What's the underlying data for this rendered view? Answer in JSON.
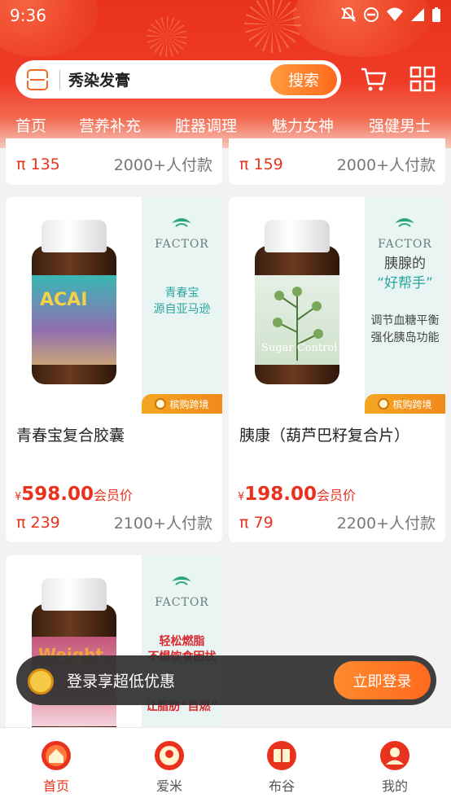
{
  "status_bar": {
    "time": "9:36"
  },
  "search": {
    "text": "秀染发膏",
    "button_label": "搜索"
  },
  "tabs": [
    {
      "label": "首页",
      "active": true
    },
    {
      "label": "营养补充"
    },
    {
      "label": "脏器调理"
    },
    {
      "label": "魅力女神"
    },
    {
      "label": "强健男士"
    }
  ],
  "top_partial": [
    {
      "pi": "π 135",
      "sold": "2000+人付款"
    },
    {
      "pi": "π 159",
      "sold": "2000+人付款"
    }
  ],
  "products": [
    {
      "brand": "FACTOR",
      "bottle_label": "ACAI",
      "side_text": [
        "青春宝",
        "源自亚马逊"
      ],
      "badge": "槟购跨境",
      "title": "青春宝复合胶囊",
      "currency": "¥",
      "price": "598.00",
      "price_label": "会员价",
      "pi": "π 239",
      "sold": "2100+人付款"
    },
    {
      "brand": "FACTOR",
      "bottle_label": "Sugar Control",
      "side_text": [
        "胰腺的",
        "“好帮手”",
        "调节血糖平衡",
        "强化胰岛功能"
      ],
      "badge": "槟购跨境",
      "title": "胰康（葫芦巴籽复合片）",
      "currency": "¥",
      "price": "198.00",
      "price_label": "会员价",
      "pi": "π 79",
      "sold": "2200+人付款"
    },
    {
      "brand": "FACTOR",
      "bottle_label": "Weight",
      "side_text": [
        "轻松燃脂",
        "不惧饮食困扰",
        "让脂肪“自燃”"
      ]
    }
  ],
  "login_toast": {
    "text": "登录享超低优惠",
    "button_label": "立即登录"
  },
  "bottom_nav": [
    {
      "label": "首页",
      "active": true
    },
    {
      "label": "爱米"
    },
    {
      "label": "布谷"
    },
    {
      "label": "我的"
    }
  ],
  "colors": {
    "accent": "#e8321e",
    "orange": "#ff6a1e",
    "panel": "#e9f5f3"
  }
}
